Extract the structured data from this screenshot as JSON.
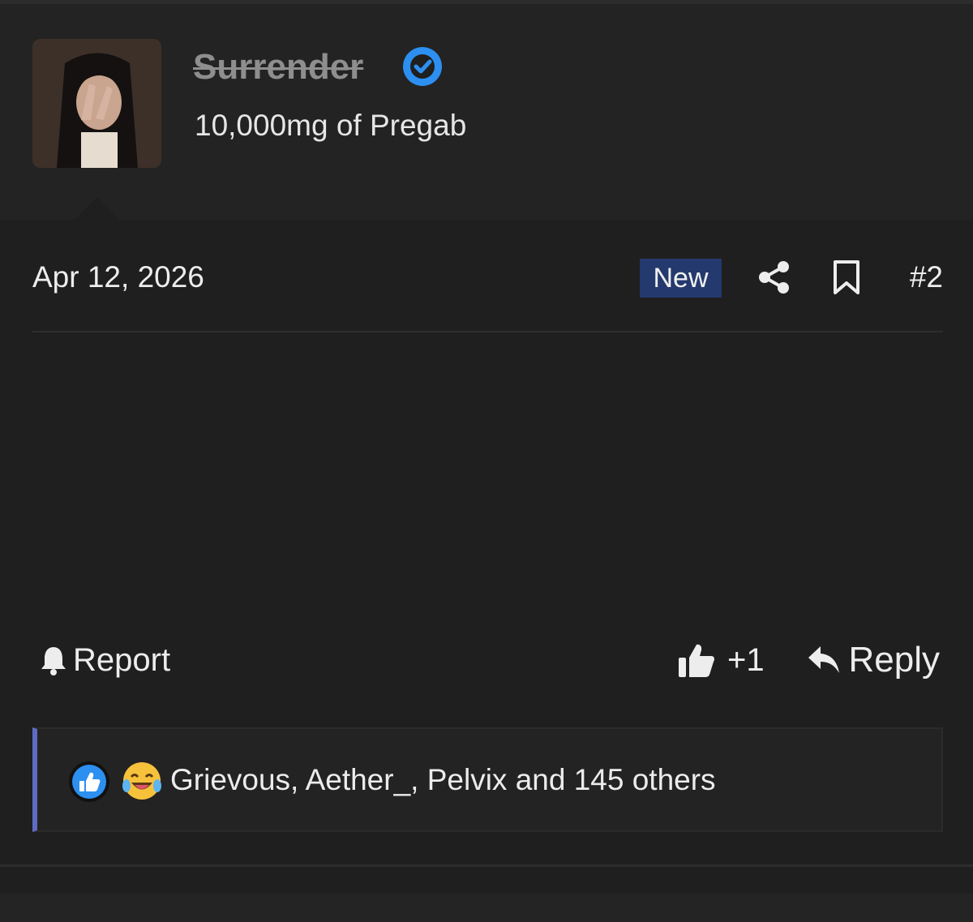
{
  "user": {
    "name": "Surrender",
    "title": "10,000mg of Pregab",
    "verified": true,
    "avatar": "avatar-photo",
    "verified_icon": "verified-check-icon"
  },
  "post": {
    "date": "Apr 12, 2026",
    "badge": "New",
    "number": "#2",
    "share_icon": "share-icon",
    "bookmark_icon": "bookmark-icon"
  },
  "actions": {
    "report_label": "Report",
    "like_count": "+1",
    "reply_label": "Reply"
  },
  "reactions": {
    "summary": "Grievous, Aether_, Pelvix and 145 others",
    "icons": [
      "like-reaction-icon",
      "laugh-reaction-icon"
    ]
  },
  "colors": {
    "background": "#1f1f1f",
    "header": "#232323",
    "badge": "#24396e",
    "verified": "#2d8ff0",
    "reaction_border": "#5f6bc2"
  }
}
